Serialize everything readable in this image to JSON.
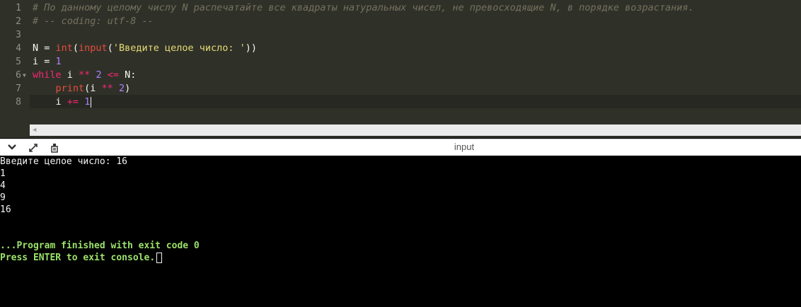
{
  "editor": {
    "line_numbers": [
      "1",
      "2",
      "3",
      "4",
      "5",
      "6",
      "7",
      "8"
    ],
    "lines": {
      "l1": "# По данному целому числу N распечатайте все квадраты натуральных чисел, не превосходящие N, в порядке возрастания.",
      "l2": "# -- coding: utf-8 --",
      "l4": {
        "a": "N = ",
        "b": "int",
        "c": "(",
        "d": "input",
        "e": "(",
        "f": "'Введите целое число: '",
        "g": "))"
      },
      "l5": {
        "a": "i = ",
        "b": "1"
      },
      "l6": {
        "a": "while",
        "b": " i ",
        "c": "**",
        "d": " ",
        "e": "2",
        "f": " ",
        "g": "<=",
        "h": " N:"
      },
      "l7": {
        "a": "    ",
        "b": "print",
        "c": "(i ",
        "d": "**",
        "e": " ",
        "f": "2",
        "g": ")"
      },
      "l8": {
        "a": "    i ",
        "b": "+=",
        "c": " ",
        "d": "1"
      }
    },
    "fold_icon": "fold-arrow-icon",
    "scroll_left_icon": "scroll-left-arrow-icon"
  },
  "toolbar": {
    "title": "input",
    "icons": [
      "chevron-down-icon",
      "expand-icon",
      "copy-icon"
    ]
  },
  "console": {
    "lines": [
      "Введите целое число: 16",
      "1",
      "4",
      "9",
      "16"
    ],
    "finish": "...Program finished with exit code 0",
    "press": "Press ENTER to exit console."
  },
  "colors": {
    "editor_bg": "#2f3129",
    "comment": "#75715e",
    "keyword": "#f92672",
    "number": "#ae81ff",
    "string": "#e6db74",
    "console_green": "#9ce26b"
  }
}
